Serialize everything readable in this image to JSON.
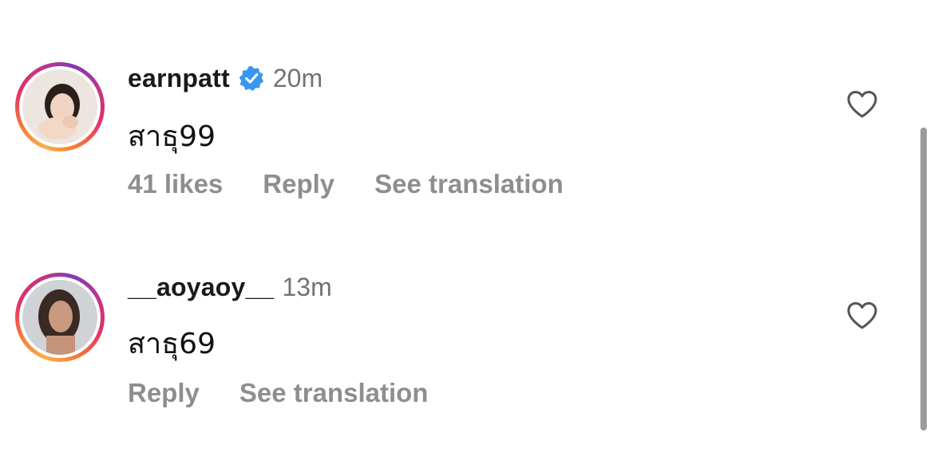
{
  "comments": [
    {
      "username": "earnpatt",
      "verified": true,
      "time": "20m",
      "text": "สาธุ99",
      "likes": "41 likes",
      "reply": "Reply",
      "see_translation": "See translation",
      "icons": {
        "verified": "verified-badge-icon",
        "like": "heart-icon"
      }
    },
    {
      "username": "__aoyaoy__",
      "verified": false,
      "time": "13m",
      "text": "สาธุ69",
      "reply": "Reply",
      "see_translation": "See translation",
      "icons": {
        "like": "heart-icon"
      }
    }
  ],
  "colors": {
    "verified_blue": "#3897f0",
    "meta_gray": "#8e8e8e",
    "text_dark": "#1a1a1a",
    "story_ring": [
      "#fcaf45",
      "#e1306c",
      "#833ab4"
    ]
  }
}
